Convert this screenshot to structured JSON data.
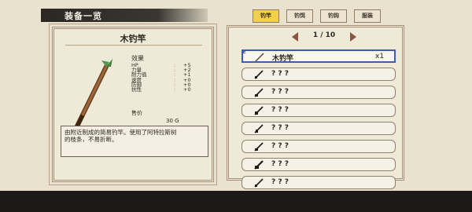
{
  "title": "装备一览",
  "detail": {
    "name": "木钓竿",
    "effect_label": "效果",
    "stats": [
      {
        "name": "HP",
        "value": "+5"
      },
      {
        "name": "力量",
        "value": "+2"
      },
      {
        "name": "耐力值",
        "value": "+1"
      },
      {
        "name": "速度",
        "value": "+0"
      },
      {
        "name": "防御",
        "value": "+0"
      },
      {
        "name": "抗性",
        "value": "+0"
      }
    ],
    "price_label": "售价",
    "price_value": "30 G",
    "description": "由附近制成的简易钓竿。使用了阿特拉斯树的枝条，不易折断。"
  },
  "tabs": [
    "钓竿",
    "钓饵",
    "钓钩",
    "服装"
  ],
  "active_tab": 0,
  "pagination": "1 / 10",
  "items": [
    {
      "label": "木钓竿",
      "qty": "x1",
      "selected": true,
      "badge": "E"
    },
    {
      "label": "? ? ?",
      "qty": "",
      "selected": false
    },
    {
      "label": "? ? ?",
      "qty": "",
      "selected": false
    },
    {
      "label": "? ? ?",
      "qty": "",
      "selected": false
    },
    {
      "label": "? ? ?",
      "qty": "",
      "selected": false
    },
    {
      "label": "? ? ?",
      "qty": "",
      "selected": false
    },
    {
      "label": "? ? ?",
      "qty": "",
      "selected": false
    },
    {
      "label": "? ? ?",
      "qty": "",
      "selected": false
    }
  ]
}
